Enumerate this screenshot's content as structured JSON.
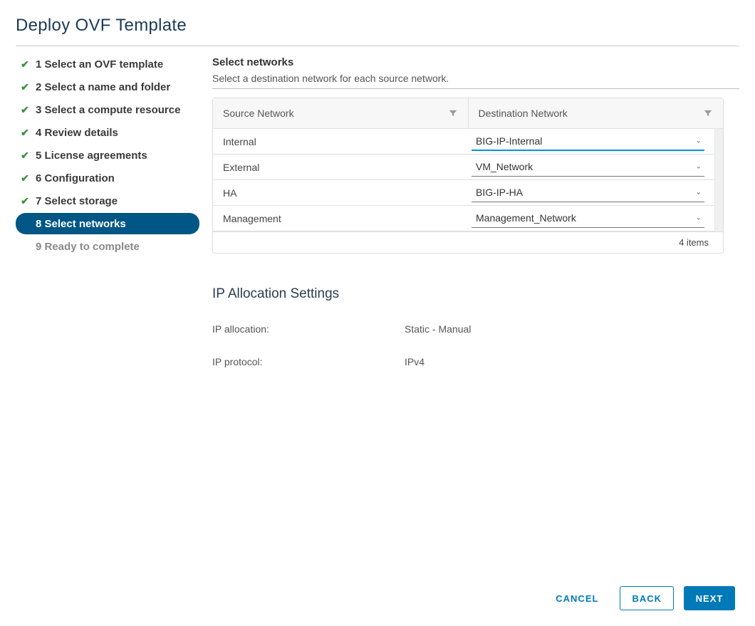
{
  "title": "Deploy OVF Template",
  "steps": [
    {
      "label": "1 Select an OVF template",
      "state": "done"
    },
    {
      "label": "2 Select a name and folder",
      "state": "done"
    },
    {
      "label": "3 Select a compute resource",
      "state": "done"
    },
    {
      "label": "4 Review details",
      "state": "done"
    },
    {
      "label": "5 License agreements",
      "state": "done"
    },
    {
      "label": "6 Configuration",
      "state": "done"
    },
    {
      "label": "7 Select storage",
      "state": "done"
    },
    {
      "label": "8 Select networks",
      "state": "active"
    },
    {
      "label": "9 Ready to complete",
      "state": "pending"
    }
  ],
  "main": {
    "heading": "Select networks",
    "desc": "Select a destination network for each source network.",
    "table": {
      "col_source": "Source Network",
      "col_dest": "Destination Network",
      "rows": [
        {
          "source": "Internal",
          "dest": "BIG-IP-Internal",
          "highlight": true
        },
        {
          "source": "External",
          "dest": "VM_Network",
          "highlight": false
        },
        {
          "source": "HA",
          "dest": "BIG-IP-HA",
          "highlight": false
        },
        {
          "source": "Management",
          "dest": "Management_Network",
          "highlight": false
        }
      ],
      "footer": "4 items"
    },
    "ipa": {
      "title": "IP Allocation Settings",
      "alloc_label": "IP allocation:",
      "alloc_value": "Static - Manual",
      "proto_label": "IP protocol:",
      "proto_value": "IPv4"
    }
  },
  "buttons": {
    "cancel": "CANCEL",
    "back": "BACK",
    "next": "NEXT"
  }
}
